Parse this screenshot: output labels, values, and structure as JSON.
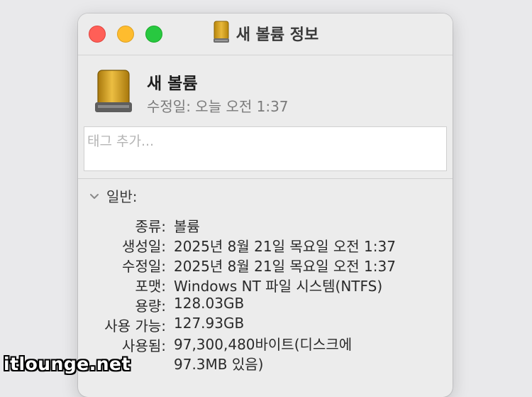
{
  "window": {
    "title": "새 볼륨 정보",
    "title_icon": "external-drive-icon"
  },
  "header": {
    "name": "새 볼륨",
    "modified": "수정일: 오늘 오전 1:37",
    "icon": "external-drive-icon"
  },
  "tags": {
    "placeholder": "태그 추가..."
  },
  "general": {
    "label": "일반:",
    "rows": [
      {
        "label": "종류:",
        "value": "볼륨"
      },
      {
        "label": "생성일:",
        "value": "2025년 8월 21일 목요일 오전 1:37"
      },
      {
        "label": "수정일:",
        "value": "2025년 8월 21일 목요일 오전 1:37"
      },
      {
        "label": "포맷:",
        "value": "Windows NT 파일 시스템(NTFS)"
      },
      {
        "label": "용량:",
        "value": "128.03GB"
      },
      {
        "label": "사용 가능:",
        "value": "127.93GB"
      },
      {
        "label": "사용됨:",
        "value_line1": "97,300,480바이트(디스크에",
        "value_line2": "97.3MB 있음)"
      }
    ]
  },
  "watermark": "itlounge.net",
  "colors": {
    "close": "#ff5f57",
    "minimize": "#febc2e",
    "zoom": "#28c840",
    "drive_gold": "#d9a422"
  }
}
